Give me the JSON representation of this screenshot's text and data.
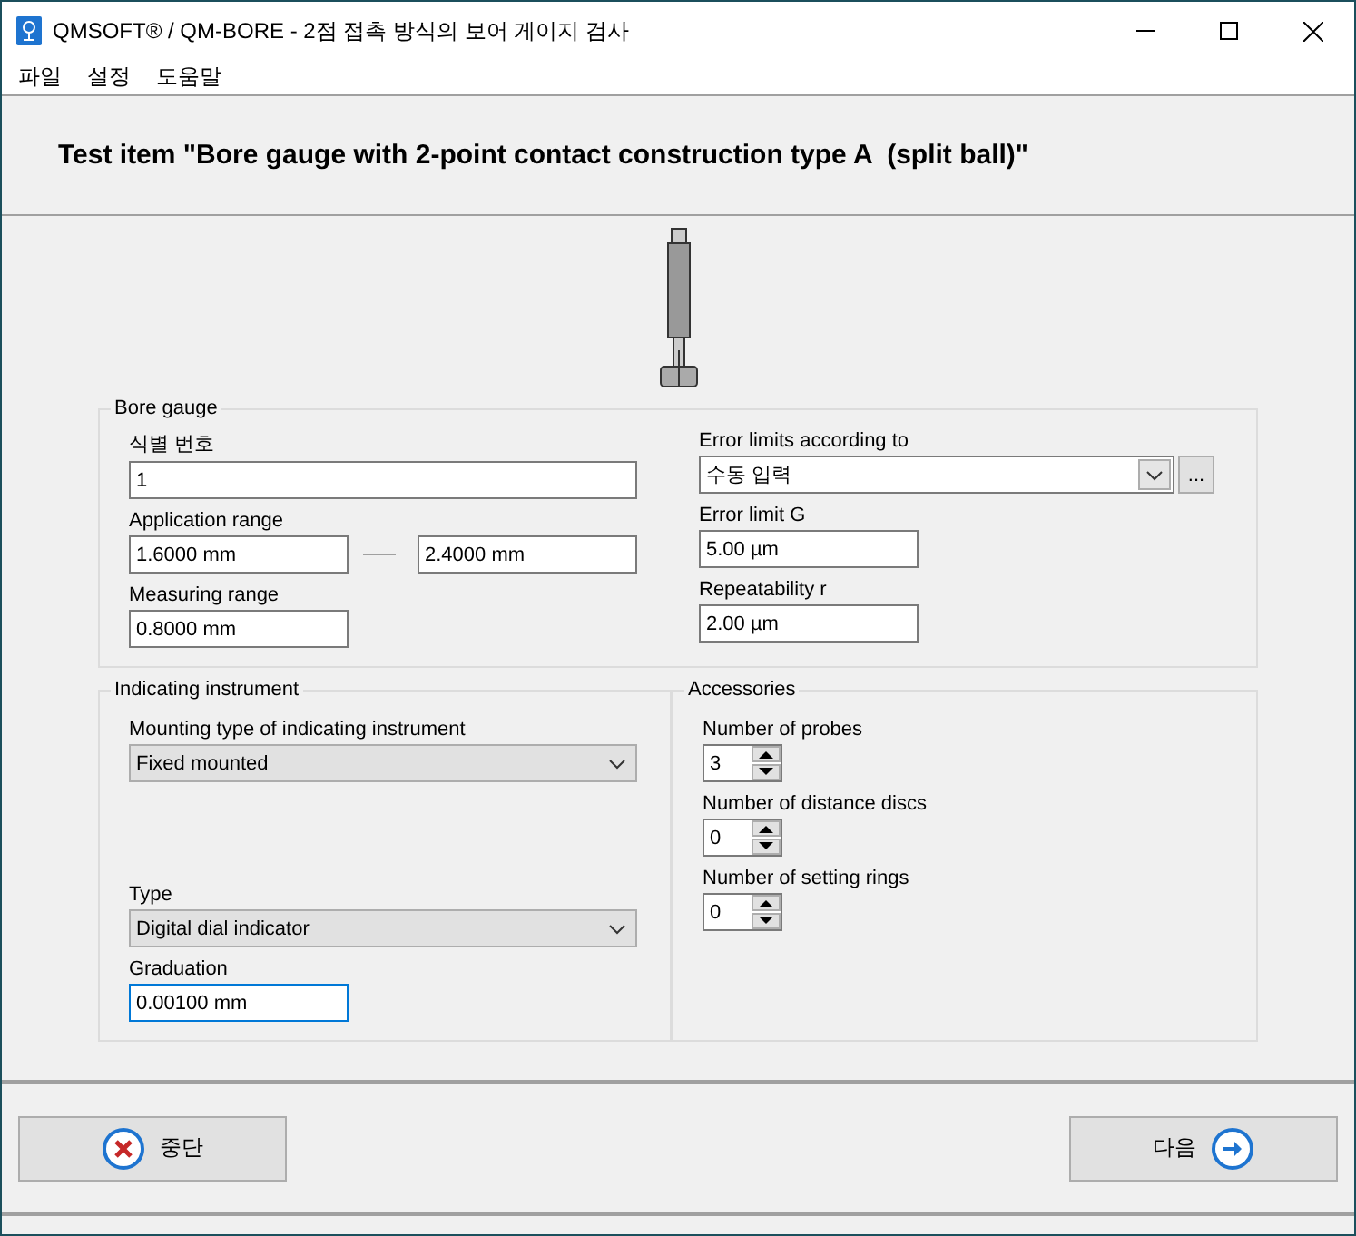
{
  "window": {
    "title": "QMSOFT® / QM-BORE - 2점 접촉 방식의 보어 게이지 검사"
  },
  "menu": [
    "파일",
    "설정",
    "도움말"
  ],
  "header": {
    "title": "Test item \"Bore gauge with 2-point contact construction type A  (split ball)\""
  },
  "bore_gauge": {
    "legend": "Bore gauge",
    "id_number": {
      "label": "식별 번호",
      "value": "1"
    },
    "application_range": {
      "label": "Application range",
      "from": "1.6000 mm",
      "to": "2.4000 mm"
    },
    "measuring_range": {
      "label": "Measuring range",
      "value": "0.8000 mm"
    },
    "error_limits_according_to": {
      "label": "Error limits according to",
      "value": "수동 입력",
      "more": "..."
    },
    "error_limit_g": {
      "label": "Error limit G",
      "value": "5.00 µm"
    },
    "repeatability": {
      "label": "Repeatability r",
      "value": "2.00 µm"
    }
  },
  "indicating_instrument": {
    "legend": "Indicating instrument",
    "mounting_type": {
      "label": "Mounting type of indicating instrument",
      "value": "Fixed mounted"
    },
    "type": {
      "label": "Type",
      "value": "Digital dial indicator"
    },
    "graduation": {
      "label": "Graduation",
      "value": "0.00100 mm",
      "focused": true
    }
  },
  "accessories": {
    "legend": "Accessories",
    "spinners": [
      {
        "label": "Number of probes",
        "value": "3"
      },
      {
        "label": "Number of distance discs",
        "value": "0"
      },
      {
        "label": "Number of setting rings",
        "value": "0"
      }
    ]
  },
  "buttons": [
    {
      "label": "중단",
      "kind": "cancel"
    },
    {
      "label": "다음",
      "kind": "next"
    }
  ]
}
